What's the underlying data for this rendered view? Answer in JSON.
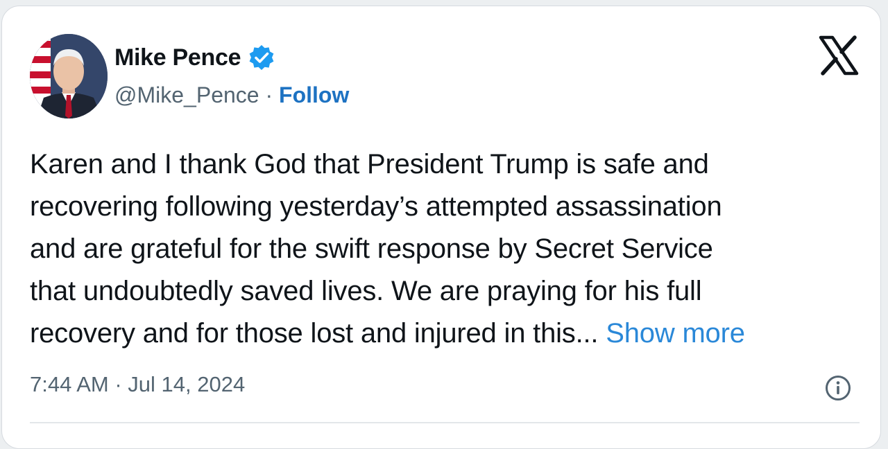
{
  "author": {
    "display_name": "Mike Pence",
    "handle": "@Mike_Pence",
    "separator": " · ",
    "follow_label": "Follow",
    "verified": true,
    "verified_badge_color": "#1d9bf0"
  },
  "platform": {
    "logo_icon": "x-logo-icon"
  },
  "tweet": {
    "lines": [
      "Karen and I thank God that President Trump is safe and",
      "recovering following yesterday’s attempted assassination",
      "and are grateful for the swift response by Secret Service",
      "that undoubtedly saved lives. We are praying for his full",
      "recovery and for those lost and injured in this..."
    ],
    "show_more_label": "Show more",
    "timestamp": "7:44 AM · Jul 14, 2024"
  },
  "colors": {
    "link": "#1d72c2",
    "show_more": "#2a88d8",
    "text": "#0f1419",
    "muted": "#536471"
  }
}
